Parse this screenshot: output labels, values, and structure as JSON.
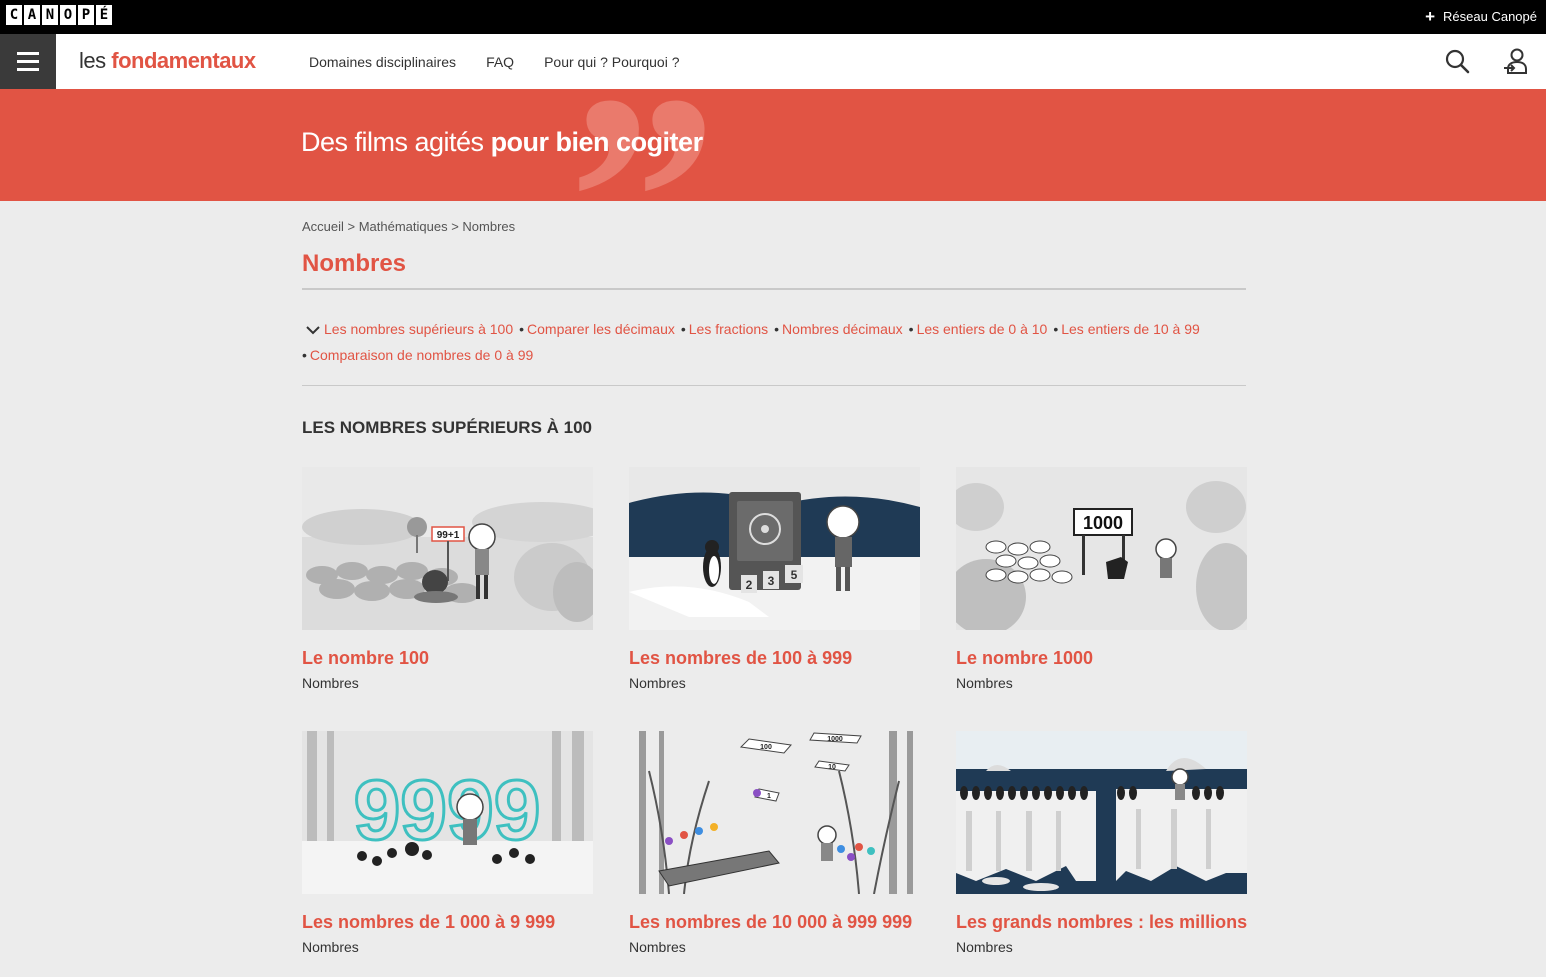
{
  "topbar": {
    "logo_letters": [
      "C",
      "A",
      "N",
      "O",
      "P",
      "É"
    ],
    "reseau_plus": "+",
    "reseau_label": "Réseau Canopé"
  },
  "header": {
    "brand_les": "les ",
    "brand_fondamentaux": "fondamentaux",
    "nav": [
      "Domaines disciplinaires",
      "FAQ",
      "Pour qui ? Pourquoi ?"
    ]
  },
  "hero": {
    "quote_mark": "”",
    "tagline_plain": "Des films agités ",
    "tagline_bold": "pour bien cogiter"
  },
  "breadcrumb": "Accueil > Mathématiques > Nombres",
  "page_title": "Nombres",
  "subnav": [
    "Les nombres supérieurs à 100",
    "Comparer les décimaux",
    "Les fractions",
    "Nombres décimaux",
    "Les entiers de 0 à 10",
    "Les entiers de 10 à 99",
    "Comparaison de nombres de 0 à 99"
  ],
  "section_title": "LES NOMBRES SUPÉRIEURS À 100",
  "cards": [
    {
      "title": "Le nombre 100",
      "subtitle": "Nombres",
      "sign": "99+1"
    },
    {
      "title": "Les nombres de 100 à 999",
      "subtitle": "Nombres",
      "digits": [
        "2",
        "3",
        "5"
      ]
    },
    {
      "title": "Le nombre 1000",
      "subtitle": "Nombres",
      "sign": "1000"
    },
    {
      "title": "Les nombres de 1 000 à 9 999",
      "subtitle": "Nombres",
      "big": "9999"
    },
    {
      "title": "Les nombres de 10 000 à 999 999",
      "subtitle": "Nombres",
      "signs": [
        "100",
        "1000",
        "10",
        "1"
      ]
    },
    {
      "title": "Les grands nombres : les millions",
      "subtitle": "Nombres"
    }
  ],
  "colors": {
    "accent": "#e15444",
    "dark": "#333333",
    "background": "#ececec"
  }
}
